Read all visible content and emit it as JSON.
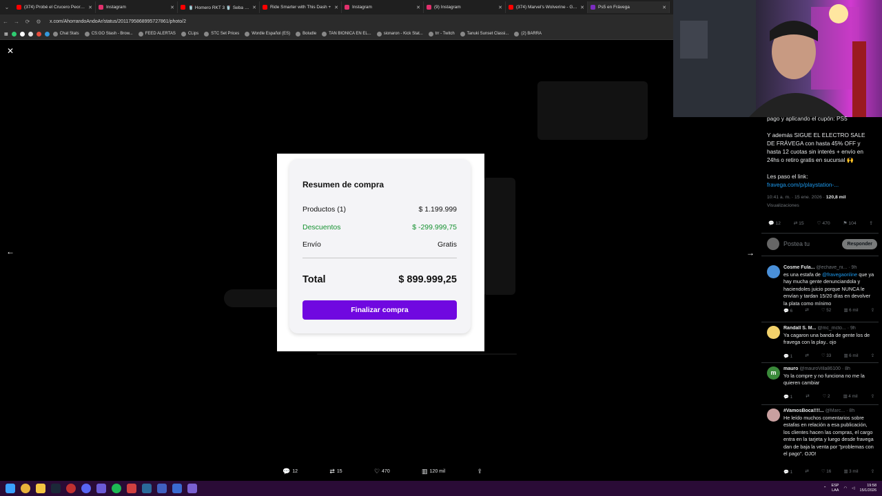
{
  "browser": {
    "tabs": [
      {
        "title": "(374) Probé el Crucero Peor Va",
        "color": "#ff0000"
      },
      {
        "title": "Instagram",
        "color": "#e1306c"
      },
      {
        "title": "🥤 Homero RKT 3 🥤 Seba Vall",
        "color": "#ff0000"
      },
      {
        "title": "Ride Smarter with This Dash +",
        "color": "#ff0000"
      },
      {
        "title": "Instagram",
        "color": "#e1306c"
      },
      {
        "title": "(9) Instagram",
        "color": "#e1306c"
      },
      {
        "title": "(374) Marvel's Wolverine - Gam",
        "color": "#ff0000"
      },
      {
        "title": "Ps5 en Frávega",
        "color": "#7b2cbf"
      }
    ],
    "url": "x.com/AhorrandoAndoAr/status/2011795868995727861/photo/2",
    "bookmarks": [
      "Chat Stats",
      "CS:GO Stash - Brow...",
      "FEED ALERTAS",
      "CLips",
      "STC Set Prices",
      "Wordle Español (ES)",
      "Boludle",
      "TAN BIONICA EN EL...",
      "sionaron - Kick Stat...",
      "trr - Twitch",
      "Tanuki Sunset Classi...",
      "(2) BARRA"
    ]
  },
  "receipt": {
    "title": "Resumen de compra",
    "products_label": "Productos (1)",
    "products_value": "$ 1.199.999",
    "discount_label": "Descuentos",
    "discount_value": "$ -299.999,75",
    "shipping_label": "Envío",
    "shipping_value": "Gratis",
    "total_label": "Total",
    "total_value": "$ 899.999,25",
    "button": "Finalizar compra"
  },
  "photo_actions": {
    "replies": "12",
    "reposts": "15",
    "likes": "470",
    "views": "120 mil"
  },
  "tweet_panel": {
    "text_top": "pago y aplicando el cupón: PS5",
    "text_main": "Y además SIGUE EL ELECTRO SALE DE FRÁVEGA con hasta 45% OFF y hasta 12 cuotas sin interés + envío en 24hs o retiro gratis en sucursal 🙌",
    "text_link_intro": "Les paso el link:",
    "link": "fravega.com/p/playstation-...",
    "time": "10:41 a. m. · 15 ene. 2026 ·",
    "views_count": "120,8 mil",
    "views_label": "Visualizaciones",
    "stats": {
      "replies": "12",
      "reposts": "15",
      "likes": "470",
      "bookmarks": "104"
    },
    "reply_placeholder": "Postea tu",
    "reply_button": "Responder",
    "comments": [
      {
        "name": "Cosme Fula...",
        "handle": "@echave_ni...",
        "time": "· 9h",
        "body_pre": "es una estafa de ",
        "mention": "@fravegaonline",
        "body": " que ya hay mucha gente denunciandola y haciendoles juicio porque NUNCA le envían y tardan 15/20 días en devolver la plata como mínimo",
        "stats": [
          "6",
          "",
          "52",
          "6 mil"
        ],
        "avatar_color": "#4a90d9"
      },
      {
        "name": "Randall S. M...",
        "handle": "@mc_mcto...",
        "time": "· 9h",
        "body": "Ya cagaron una banda de gente los de fravega con la play.. ojo",
        "stats": [
          "1",
          "",
          "33",
          "6 mil"
        ],
        "avatar_color": "#f2d16b"
      },
      {
        "name": "mauro",
        "handle": "@mauroVilla86100",
        "time": "· 8h",
        "body": "Yo la compre y no funciona no me la quieren cambiar",
        "stats": [
          "1",
          "",
          "2",
          "4 mil"
        ],
        "avatar_color": "#3a8a3a",
        "avatar_letter": "m"
      },
      {
        "name": "#VamosBoca!!!!...",
        "handle": "@Marc...",
        "time": "· 8h",
        "body": "He leído muchos comentarios sobre estafas en relación a esa publicación, los clientes hacen las compras, el cargo entra en la tarjeta y luego desde fravega dan de baja la venta por \"problemas con el pago\". OJO!",
        "stats": [
          "1",
          "",
          "16",
          "3 mil"
        ],
        "avatar_color": "#c9a0a0"
      }
    ]
  },
  "taskbar": {
    "lang1": "ESP",
    "lang2": "LAA",
    "time": "19:58",
    "date": "15/1/2026"
  }
}
